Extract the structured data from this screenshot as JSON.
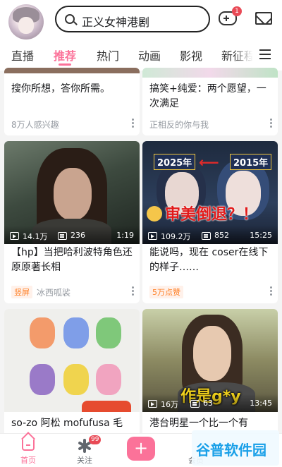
{
  "header": {
    "search_text": "正义女神港剧",
    "game_badge": "1"
  },
  "tabs": [
    {
      "label": "直播"
    },
    {
      "label": "推荐"
    },
    {
      "label": "热门"
    },
    {
      "label": "动画"
    },
    {
      "label": "影视"
    },
    {
      "label": "新征程"
    }
  ],
  "cards": [
    {
      "title": "搜你所想，答你所需。",
      "sub": "8万人感兴趣"
    },
    {
      "title": "搞笑+纯爱：两个愿望，一次满足",
      "sub": "正相反的你与我"
    },
    {
      "title": "【hp】当把哈利波特角色还原原著长相",
      "tag": "竖屏",
      "sub": "冰西呱裟",
      "views": "14.1万",
      "danmaku": "236",
      "duration": "1:19"
    },
    {
      "title": "能说吗，现在 coser在线下的样子……",
      "tag": "5万点赞",
      "views": "109.2万",
      "danmaku": "852",
      "duration": "15:25",
      "overlay": {
        "year_left": "2025年",
        "year_right": "2015年",
        "caption": "审美倒退？！"
      }
    },
    {
      "title": "so-zo 阿松 mofufusa 毛",
      "overlay": {}
    },
    {
      "title": "港台明星一个比一个有",
      "views": "16万",
      "danmaku": "63",
      "duration": "13:45",
      "overlay": {
        "caption": "作是g*y"
      }
    }
  ],
  "nav": [
    {
      "label": "首页"
    },
    {
      "label": "关注",
      "badge": "99"
    },
    {
      "label": "+"
    },
    {
      "label": "会员"
    }
  ],
  "watermark": "谷普软件园",
  "colors": {
    "accent": "#fb7299",
    "badge": "#e94a56"
  }
}
